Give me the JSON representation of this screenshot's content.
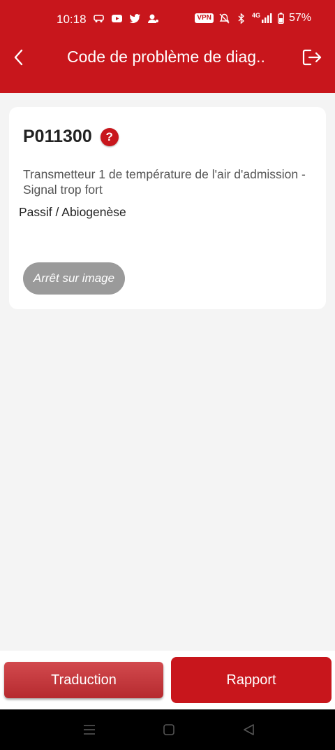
{
  "status_bar": {
    "time": "10:18",
    "left_icons": [
      "car-icon",
      "youtube-icon",
      "twitter-icon",
      "notification-icon"
    ],
    "vpn": "VPN",
    "network": "4G",
    "battery": "57%",
    "right_icons": [
      "mute-icon",
      "bluetooth-icon",
      "signal-icon",
      "battery-icon"
    ]
  },
  "app_bar": {
    "title": "Code de problème de diag..",
    "back_icon": "back-icon",
    "exit_icon": "exit-icon",
    "color": "#c8161c"
  },
  "dtc": {
    "code": "P011300",
    "help": "?",
    "description": "Transmetteur 1 de température de l'air d'admission - Signal trop fort",
    "status": "Passif / Abiogenèse",
    "freeze_frame_label": "Arrêt sur image"
  },
  "actions": {
    "translate_label": "Traduction",
    "report_label": "Rapport"
  },
  "system_nav": {
    "icons": [
      "menu-icon",
      "home-icon",
      "back-triangle-icon"
    ]
  }
}
